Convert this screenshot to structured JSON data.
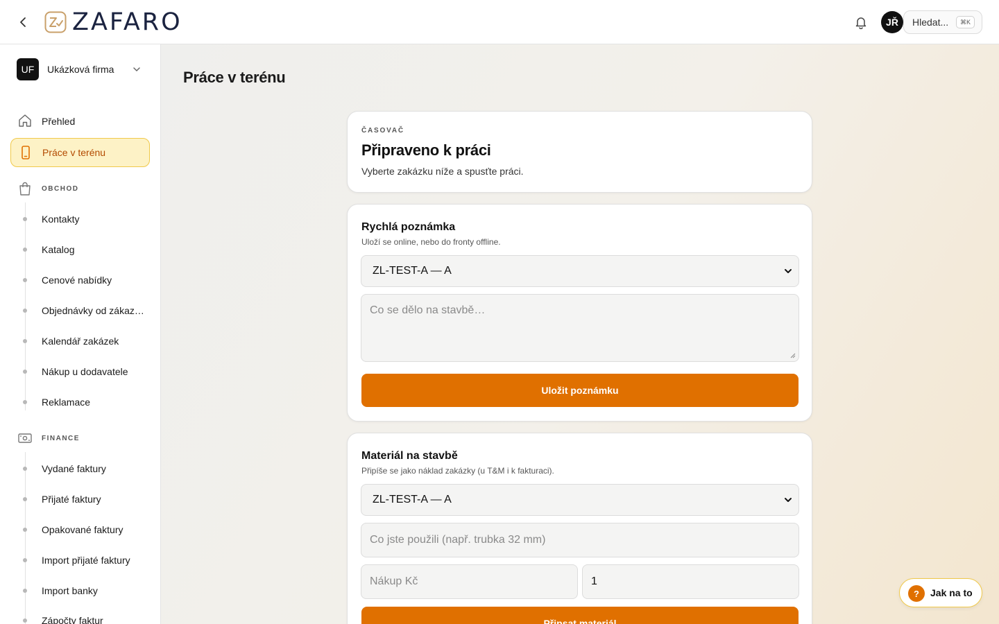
{
  "topbar": {
    "back_icon": "chevron-left-icon",
    "logo_text": "ZAFARO",
    "bell_icon": "bell-icon",
    "user_initials": "JŘ",
    "search_label": "Hledat...",
    "search_shortcut": "⌘K"
  },
  "sidebar": {
    "company": {
      "initials": "UF",
      "name": "Ukázková firma"
    },
    "items": [
      {
        "label": "Přehled",
        "icon": "home-icon"
      },
      {
        "label": "Práce v terénu",
        "icon": "phone-icon",
        "active": true
      }
    ],
    "sections": [
      {
        "label": "OBCHOD",
        "icon": "shopping-bag-icon",
        "items": [
          "Kontakty",
          "Katalog",
          "Cenové nabídky",
          "Objednávky od zákazníků",
          "Kalendář zakázek",
          "Nákup u dodavatele",
          "Reklamace"
        ]
      },
      {
        "label": "FINANCE",
        "icon": "banknote-icon",
        "items": [
          "Vydané faktury",
          "Přijaté faktury",
          "Opakované faktury",
          "Import přijaté faktury",
          "Import banky",
          "Zápočty faktur"
        ]
      }
    ]
  },
  "main": {
    "page_title": "Práce v terénu",
    "timer": {
      "eyebrow": "ČASOVAČ",
      "title": "Připraveno k práci",
      "description": "Vyberte zakázku níže a spusťte práci."
    },
    "note": {
      "title": "Rychlá poznámka",
      "subtitle": "Uloží se online, nebo do fronty offline.",
      "select_value": "ZL-TEST-A — A",
      "textarea_placeholder": "Co se dělo na stavbě…",
      "save_label": "Uložit poznámku"
    },
    "material": {
      "title": "Materiál na stavbě",
      "subtitle": "Připíše se jako náklad zakázky (u T&M i k fakturaci).",
      "select_value": "ZL-TEST-A — A",
      "name_placeholder": "Co jste použili (např. trubka 32 mm)",
      "price_placeholder": "Nákup Kč",
      "quantity_value": "1",
      "add_label": "Připsat materiál"
    }
  },
  "help": {
    "label": "Jak na to",
    "icon_glyph": "?"
  },
  "colors": {
    "accent": "#e07000",
    "active_bg": "#fdf2c6",
    "active_border": "#f0c94a",
    "active_text": "#b34a00",
    "logo": "#1b2340"
  }
}
